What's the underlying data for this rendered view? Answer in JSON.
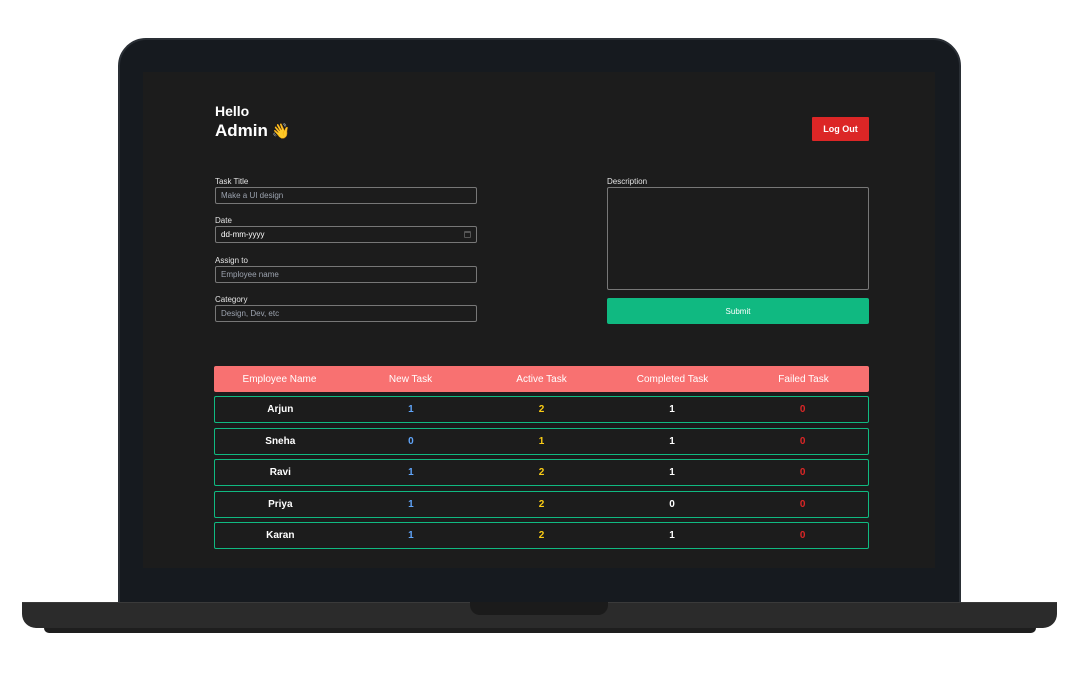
{
  "greeting": {
    "hello": "Hello",
    "name": "Admin",
    "emoji": "👋"
  },
  "header": {
    "logout_label": "Log Out"
  },
  "form": {
    "task_title": {
      "label": "Task Title",
      "placeholder": "Make a UI design"
    },
    "date": {
      "label": "Date",
      "value": "dd-mm-yyyy"
    },
    "assign_to": {
      "label": "Assign to",
      "placeholder": "Employee name"
    },
    "category": {
      "label": "Category",
      "placeholder": "Design, Dev, etc"
    },
    "description": {
      "label": "Description"
    },
    "submit_label": "Submit"
  },
  "table": {
    "columns": [
      "Employee Name",
      "New Task",
      "Active Task",
      "Completed Task",
      "Failed Task"
    ],
    "rows": [
      {
        "name": "Arjun",
        "new": "1",
        "active": "2",
        "completed": "1",
        "failed": "0"
      },
      {
        "name": "Sneha",
        "new": "0",
        "active": "1",
        "completed": "1",
        "failed": "0"
      },
      {
        "name": "Ravi",
        "new": "1",
        "active": "2",
        "completed": "1",
        "failed": "0"
      },
      {
        "name": "Priya",
        "new": "1",
        "active": "2",
        "completed": "0",
        "failed": "0"
      },
      {
        "name": "Karan",
        "new": "1",
        "active": "2",
        "completed": "1",
        "failed": "0"
      }
    ]
  },
  "colors": {
    "background": "#1c1c1c",
    "logout": "#dc2626",
    "submit": "#10b981",
    "table_header": "#f87171",
    "row_border": "#10b981",
    "new_task": "#60a5fa",
    "active_task": "#facc15",
    "failed_task": "#dc2626"
  }
}
